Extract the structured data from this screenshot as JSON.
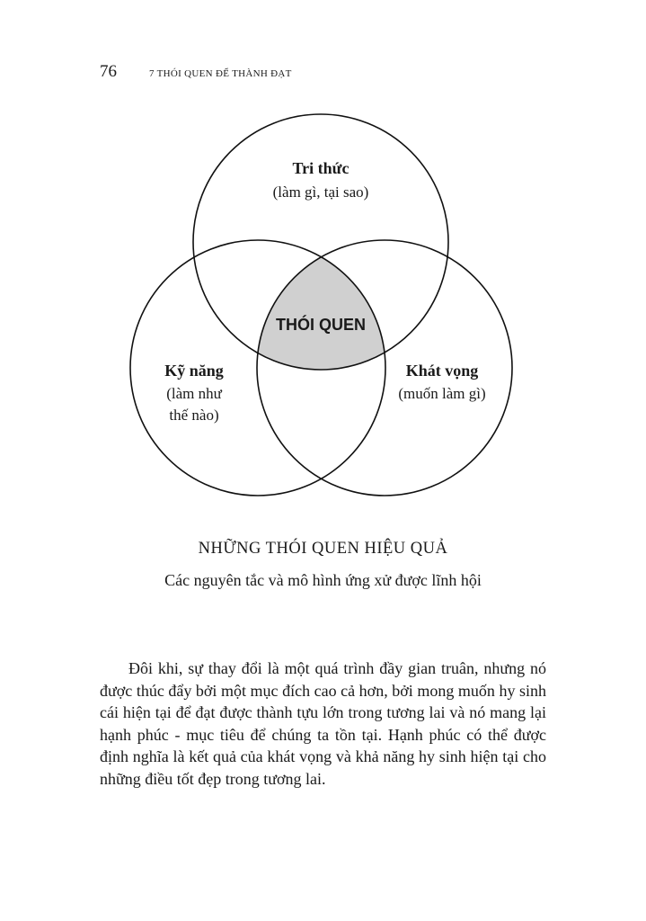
{
  "header": {
    "page_number": "76",
    "book_title": "7 THÓI QUEN ĐỂ THÀNH ĐẠT"
  },
  "diagram": {
    "top_circle": {
      "title": "Tri thức",
      "subtitle": "(làm gì, tại sao)"
    },
    "left_circle": {
      "title": "Kỹ năng",
      "subtitle_line1": "(làm như",
      "subtitle_line2": "thế nào)"
    },
    "right_circle": {
      "title": "Khát vọng",
      "subtitle": "(muốn làm gì)"
    },
    "center_label": "THÓI QUEN",
    "colors": {
      "intersection_fill": "#d0d0d0",
      "stroke": "#111111"
    }
  },
  "caption": {
    "title": "NHỮNG THÓI QUEN HIỆU QUẢ",
    "subtitle": "Các nguyên tắc và mô hình ứng xử được lĩnh hội"
  },
  "body": {
    "paragraph": "Đôi khi, sự thay đổi là một quá trình đầy gian truân, nhưng nó được thúc đẩy bởi một mục đích cao cả hơn, bởi mong muốn hy sinh cái hiện tại để đạt được thành tựu lớn trong tương lai và nó mang lại hạnh phúc - mục tiêu để chúng ta tồn tại. Hạnh phúc có thể được định nghĩa là kết quả của khát vọng và khả năng hy sinh hiện tại cho những điều tốt đẹp trong tương lai."
  }
}
